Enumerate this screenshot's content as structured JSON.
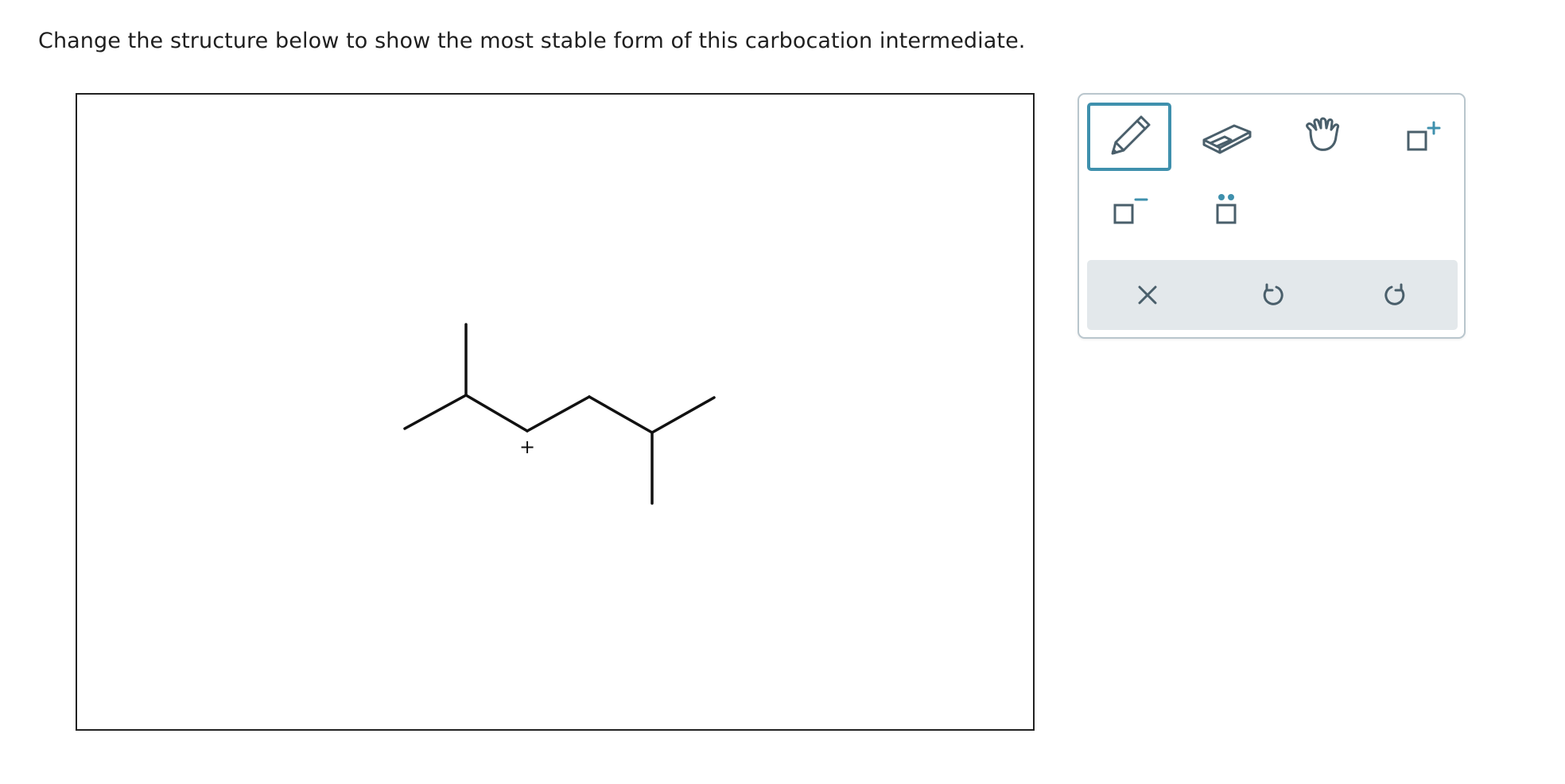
{
  "prompt": {
    "text": "Change the structure below to show the most stable form of this carbocation intermediate."
  },
  "canvas": {
    "charge_label": "+"
  },
  "toolbox": {
    "tools": [
      {
        "name": "pencil-tool",
        "icon": "pencil-icon",
        "selected": true
      },
      {
        "name": "eraser-tool",
        "icon": "eraser-icon",
        "selected": false
      },
      {
        "name": "hand-tool",
        "icon": "hand-icon",
        "selected": false
      },
      {
        "name": "positive-charge-tool",
        "icon": "positive-charge-icon",
        "label": "+",
        "selected": false
      },
      {
        "name": "negative-charge-tool",
        "icon": "negative-charge-icon",
        "label": "−",
        "selected": false
      },
      {
        "name": "lone-pair-tool",
        "icon": "lone-pair-icon",
        "selected": false
      }
    ],
    "actions": [
      {
        "name": "clear-button",
        "icon": "close-icon"
      },
      {
        "name": "undo-button",
        "icon": "undo-icon"
      },
      {
        "name": "redo-button",
        "icon": "redo-icon"
      }
    ]
  },
  "colors": {
    "accent": "#3f90ad",
    "icon": "#4a5f6b",
    "action_bar": "#e3e8eb",
    "toolbox_border": "#b9c6cd"
  }
}
